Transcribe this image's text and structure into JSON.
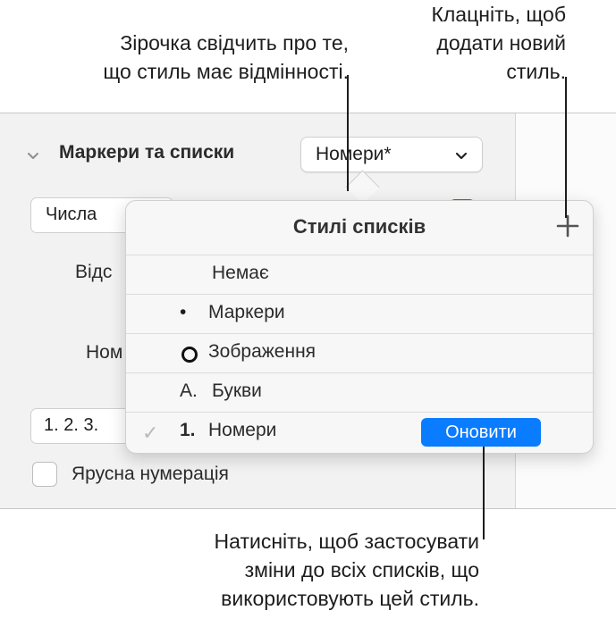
{
  "callouts": {
    "asterisk": "Зірочка свідчить про те,\nщо стиль має відмінності.",
    "add_style": "Клацніть, щоб\nдодати новий\nстиль.",
    "update": "Натисніть, щоб застосувати\nзміни до всіх списків, що\nвикористовують цей стиль."
  },
  "inspector": {
    "section_title": "Маркери та списки",
    "style_popup_value": "Номери*",
    "type_field_value": "Числа",
    "indent_label": "Відс",
    "number_label": "Ном",
    "format_value": "1. 2. 3.",
    "tiered_label": "Ярусна нумерація"
  },
  "popover": {
    "title": "Стилі списків",
    "items": [
      {
        "label": "Немає",
        "prefix": ""
      },
      {
        "label": "Маркери",
        "prefix": "•"
      },
      {
        "label": "Зображення",
        "prefix": ""
      },
      {
        "label": "Букви",
        "prefix": "A."
      },
      {
        "label": "Номери",
        "prefix": "1.",
        "checkmark": "✓"
      }
    ],
    "update_button": "Оновити"
  },
  "colors": {
    "accent": "#0a7cff",
    "text": "#1d1d1f",
    "panel_bg": "#f2f2f2"
  }
}
